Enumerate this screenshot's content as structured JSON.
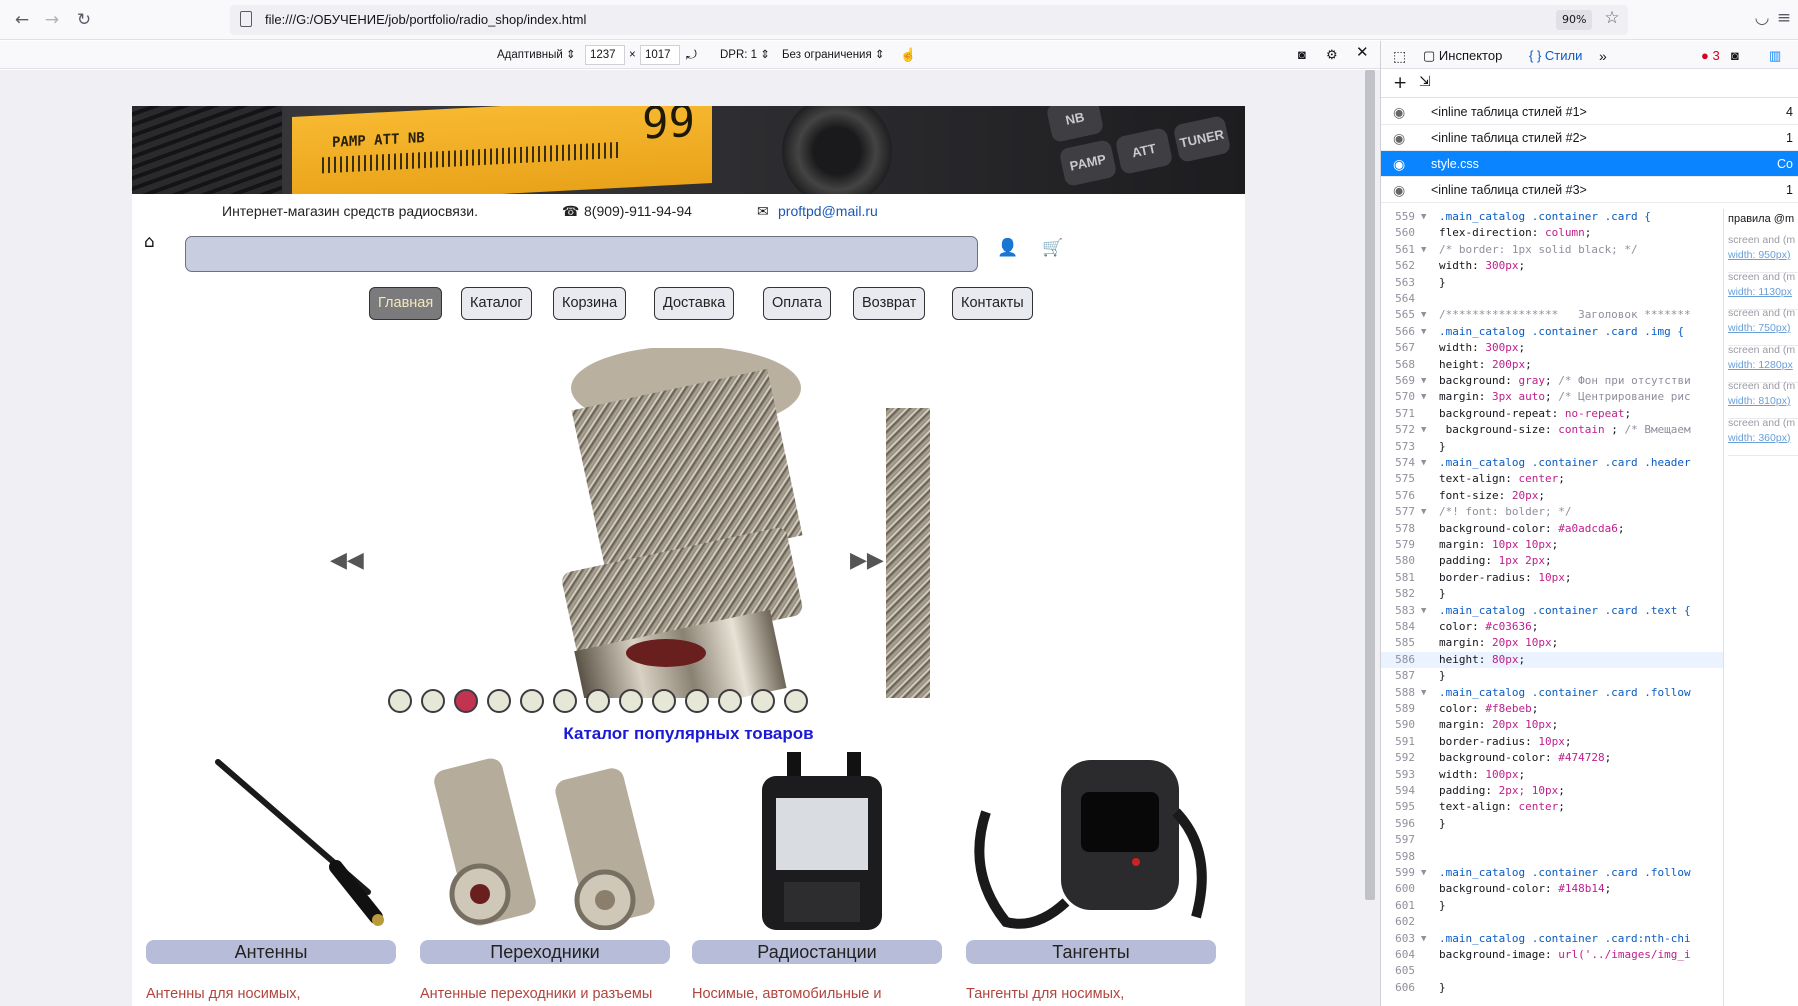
{
  "browser": {
    "url": "file:///G:/ОБУЧЕНИЕ/job/portfolio/radio_shop/index.html",
    "zoom": "90%"
  },
  "rdm": {
    "preset": "Адаптивный",
    "width": "1237",
    "times": "×",
    "height": "1017",
    "dpr": "DPR: 1",
    "throttle": "Без ограничения"
  },
  "banner": {
    "lcd_text": "PAMP ATT NB",
    "lcd_digits": "99",
    "keys": [
      "NB",
      "PAMP",
      "ATT",
      "TUNER"
    ]
  },
  "site": {
    "tagline": "Интернет-магазин средств радиосвязи.",
    "phone": "8(909)-911-94-94",
    "email": "proftpd@mail.ru",
    "menu": [
      "Главная",
      "Каталог",
      "Корзина",
      "Доставка",
      "Оплата",
      "Возврат",
      "Контакты"
    ],
    "active_menu": 0,
    "slider": {
      "dots": 13,
      "active": 2,
      "prev": "◀◀",
      "next": "▶▶"
    },
    "catalog_title": "Каталог популярных товаров",
    "cards": [
      {
        "title": "Антенны",
        "text": "Антенны для носимых, автомобильных и базовых"
      },
      {
        "title": "Переходники",
        "text": "Антенные переходники и разъемы для радиостанций"
      },
      {
        "title": "Радиостанции",
        "text": "Носимые, автомобильные и базовые радиостанции"
      },
      {
        "title": "Тангенты",
        "text": "Тангенты для носимых, автомобильных и базовых"
      }
    ]
  },
  "devtools": {
    "tab_inspector": "Инспектор",
    "tab_styles": "Стили",
    "errors": "3",
    "sheets": [
      {
        "name": "<inline таблица стилей #1>",
        "count": "4",
        "selected": false
      },
      {
        "name": "<inline таблица стилей #2>",
        "count": "1",
        "selected": false
      },
      {
        "name": "style.css",
        "count": "Co",
        "selected": true
      },
      {
        "name": "<inline таблица стилей #3>",
        "count": "1",
        "selected": false
      }
    ],
    "code": [
      {
        "n": "559",
        "fold": true,
        "t": [
          [
            "sel-c",
            ".main_catalog .container .card {"
          ]
        ]
      },
      {
        "n": "560",
        "t": [
          [
            "prop-c",
            "flex-direction: "
          ],
          [
            "val-c",
            "column"
          ],
          [
            "prop-c",
            ";"
          ]
        ]
      },
      {
        "n": "561",
        "fold": true,
        "t": [
          [
            "com-c",
            "/* border: 1px solid black; */"
          ]
        ]
      },
      {
        "n": "562",
        "t": [
          [
            "prop-c",
            "width: "
          ],
          [
            "val-c",
            "300px"
          ],
          [
            "prop-c",
            ";"
          ]
        ]
      },
      {
        "n": "563",
        "t": [
          [
            "prop-c",
            "}"
          ]
        ]
      },
      {
        "n": "564",
        "t": []
      },
      {
        "n": "565",
        "fold": true,
        "t": [
          [
            "com-c",
            "/*****************   Заголовок *******"
          ]
        ]
      },
      {
        "n": "566",
        "fold": true,
        "t": [
          [
            "sel-c",
            ".main_catalog .container .card .img {"
          ]
        ]
      },
      {
        "n": "567",
        "t": [
          [
            "prop-c",
            "width: "
          ],
          [
            "val-c",
            "300px"
          ],
          [
            "prop-c",
            ";"
          ]
        ]
      },
      {
        "n": "568",
        "t": [
          [
            "prop-c",
            "height: "
          ],
          [
            "val-c",
            "200px"
          ],
          [
            "prop-c",
            ";"
          ]
        ]
      },
      {
        "n": "569",
        "fold": true,
        "t": [
          [
            "prop-c",
            "background: "
          ],
          [
            "val-c",
            "gray"
          ],
          [
            "prop-c",
            "; "
          ],
          [
            "com-c",
            "/* Фон при отсутстви"
          ]
        ]
      },
      {
        "n": "570",
        "fold": true,
        "t": [
          [
            "prop-c",
            "margin: "
          ],
          [
            "val-c",
            "3px auto"
          ],
          [
            "prop-c",
            "; "
          ],
          [
            "com-c",
            "/* Центрирование рис"
          ]
        ]
      },
      {
        "n": "571",
        "t": [
          [
            "prop-c",
            "background-repeat: "
          ],
          [
            "val-c",
            "no-repeat"
          ],
          [
            "prop-c",
            ";"
          ]
        ]
      },
      {
        "n": "572",
        "fold": true,
        "t": [
          [
            "prop-c",
            " background-size: "
          ],
          [
            "val-c",
            "contain"
          ],
          [
            "prop-c",
            " ; "
          ],
          [
            "com-c",
            "/* Вмещаем"
          ]
        ]
      },
      {
        "n": "573",
        "t": [
          [
            "prop-c",
            "}"
          ]
        ]
      },
      {
        "n": "574",
        "fold": true,
        "t": [
          [
            "sel-c",
            ".main_catalog .container .card .header"
          ]
        ]
      },
      {
        "n": "575",
        "t": [
          [
            "prop-c",
            "text-align: "
          ],
          [
            "val-c",
            "center"
          ],
          [
            "prop-c",
            ";"
          ]
        ]
      },
      {
        "n": "576",
        "t": [
          [
            "prop-c",
            "font-size: "
          ],
          [
            "val-c",
            "20px"
          ],
          [
            "prop-c",
            ";"
          ]
        ]
      },
      {
        "n": "577",
        "fold": true,
        "t": [
          [
            "com-c",
            "/*! font: bolder; */"
          ]
        ]
      },
      {
        "n": "578",
        "t": [
          [
            "prop-c",
            "background-color: "
          ],
          [
            "val-c",
            "#a0adcda6"
          ],
          [
            "prop-c",
            ";"
          ]
        ]
      },
      {
        "n": "579",
        "t": [
          [
            "prop-c",
            "margin: "
          ],
          [
            "val-c",
            "10px 10px"
          ],
          [
            "prop-c",
            ";"
          ]
        ]
      },
      {
        "n": "580",
        "t": [
          [
            "prop-c",
            "padding: "
          ],
          [
            "val-c",
            "1px 2px"
          ],
          [
            "prop-c",
            ";"
          ]
        ]
      },
      {
        "n": "581",
        "t": [
          [
            "prop-c",
            "border-radius: "
          ],
          [
            "val-c",
            "10px"
          ],
          [
            "prop-c",
            ";"
          ]
        ]
      },
      {
        "n": "582",
        "t": [
          [
            "prop-c",
            "}"
          ]
        ]
      },
      {
        "n": "583",
        "fold": true,
        "t": [
          [
            "sel-c",
            ".main_catalog .container .card .text {"
          ]
        ]
      },
      {
        "n": "584",
        "t": [
          [
            "prop-c",
            "color: "
          ],
          [
            "val-c",
            "#c03636"
          ],
          [
            "prop-c",
            ";"
          ]
        ]
      },
      {
        "n": "585",
        "t": [
          [
            "prop-c",
            "margin: "
          ],
          [
            "val-c",
            "20px 10px"
          ],
          [
            "prop-c",
            ";"
          ]
        ]
      },
      {
        "n": "586",
        "hl": true,
        "t": [
          [
            "prop-c",
            "height: "
          ],
          [
            "val-c",
            "80px"
          ],
          [
            "prop-c",
            ";"
          ]
        ]
      },
      {
        "n": "587",
        "t": [
          [
            "prop-c",
            "}"
          ]
        ]
      },
      {
        "n": "588",
        "fold": true,
        "t": [
          [
            "sel-c",
            ".main_catalog .container .card .follow"
          ]
        ]
      },
      {
        "n": "589",
        "t": [
          [
            "prop-c",
            "color: "
          ],
          [
            "val-c",
            "#f8ebeb"
          ],
          [
            "prop-c",
            ";"
          ]
        ]
      },
      {
        "n": "590",
        "t": [
          [
            "prop-c",
            "margin: "
          ],
          [
            "val-c",
            "20px 10px"
          ],
          [
            "prop-c",
            ";"
          ]
        ]
      },
      {
        "n": "591",
        "t": [
          [
            "prop-c",
            "border-radius: "
          ],
          [
            "val-c",
            "10px"
          ],
          [
            "prop-c",
            ";"
          ]
        ]
      },
      {
        "n": "592",
        "t": [
          [
            "prop-c",
            "background-color: "
          ],
          [
            "val-c",
            "#474728"
          ],
          [
            "prop-c",
            ";"
          ]
        ]
      },
      {
        "n": "593",
        "t": [
          [
            "prop-c",
            "width: "
          ],
          [
            "val-c",
            "100px"
          ],
          [
            "prop-c",
            ";"
          ]
        ]
      },
      {
        "n": "594",
        "t": [
          [
            "prop-c",
            "padding: "
          ],
          [
            "val-c",
            "2px; 10px"
          ],
          [
            "prop-c",
            ";"
          ]
        ]
      },
      {
        "n": "595",
        "t": [
          [
            "prop-c",
            "text-align: "
          ],
          [
            "val-c",
            "center"
          ],
          [
            "prop-c",
            ";"
          ]
        ]
      },
      {
        "n": "596",
        "t": [
          [
            "prop-c",
            "}"
          ]
        ]
      },
      {
        "n": "597",
        "t": []
      },
      {
        "n": "598",
        "t": []
      },
      {
        "n": "599",
        "fold": true,
        "t": [
          [
            "sel-c",
            ".main_catalog .container .card .follow"
          ]
        ]
      },
      {
        "n": "600",
        "t": [
          [
            "prop-c",
            "background-color: "
          ],
          [
            "val-c",
            "#148b14"
          ],
          [
            "prop-c",
            ";"
          ]
        ]
      },
      {
        "n": "601",
        "t": [
          [
            "prop-c",
            "}"
          ]
        ]
      },
      {
        "n": "602",
        "t": []
      },
      {
        "n": "603",
        "fold": true,
        "t": [
          [
            "sel-c",
            ".main_catalog .container .card:nth-chi"
          ]
        ]
      },
      {
        "n": "604",
        "t": [
          [
            "prop-c",
            "background-image: "
          ],
          [
            "val-c",
            "url('../images/img_i"
          ]
        ]
      },
      {
        "n": "605",
        "t": []
      },
      {
        "n": "606",
        "t": [
          [
            "prop-c",
            "}"
          ]
        ]
      }
    ],
    "side_title": "правила @m",
    "media": [
      {
        "a": "screen and (m",
        "b": "width: 950px)"
      },
      {
        "a": "screen and (m",
        "b": "width: 1130px"
      },
      {
        "a": "screen and (m",
        "b": "width: 750px)"
      },
      {
        "a": "screen and (m",
        "b": "width: 1280px"
      },
      {
        "a": "screen and (m",
        "b": "width: 810px)"
      },
      {
        "a": "screen and (m",
        "b": "width: 360px)"
      }
    ]
  }
}
